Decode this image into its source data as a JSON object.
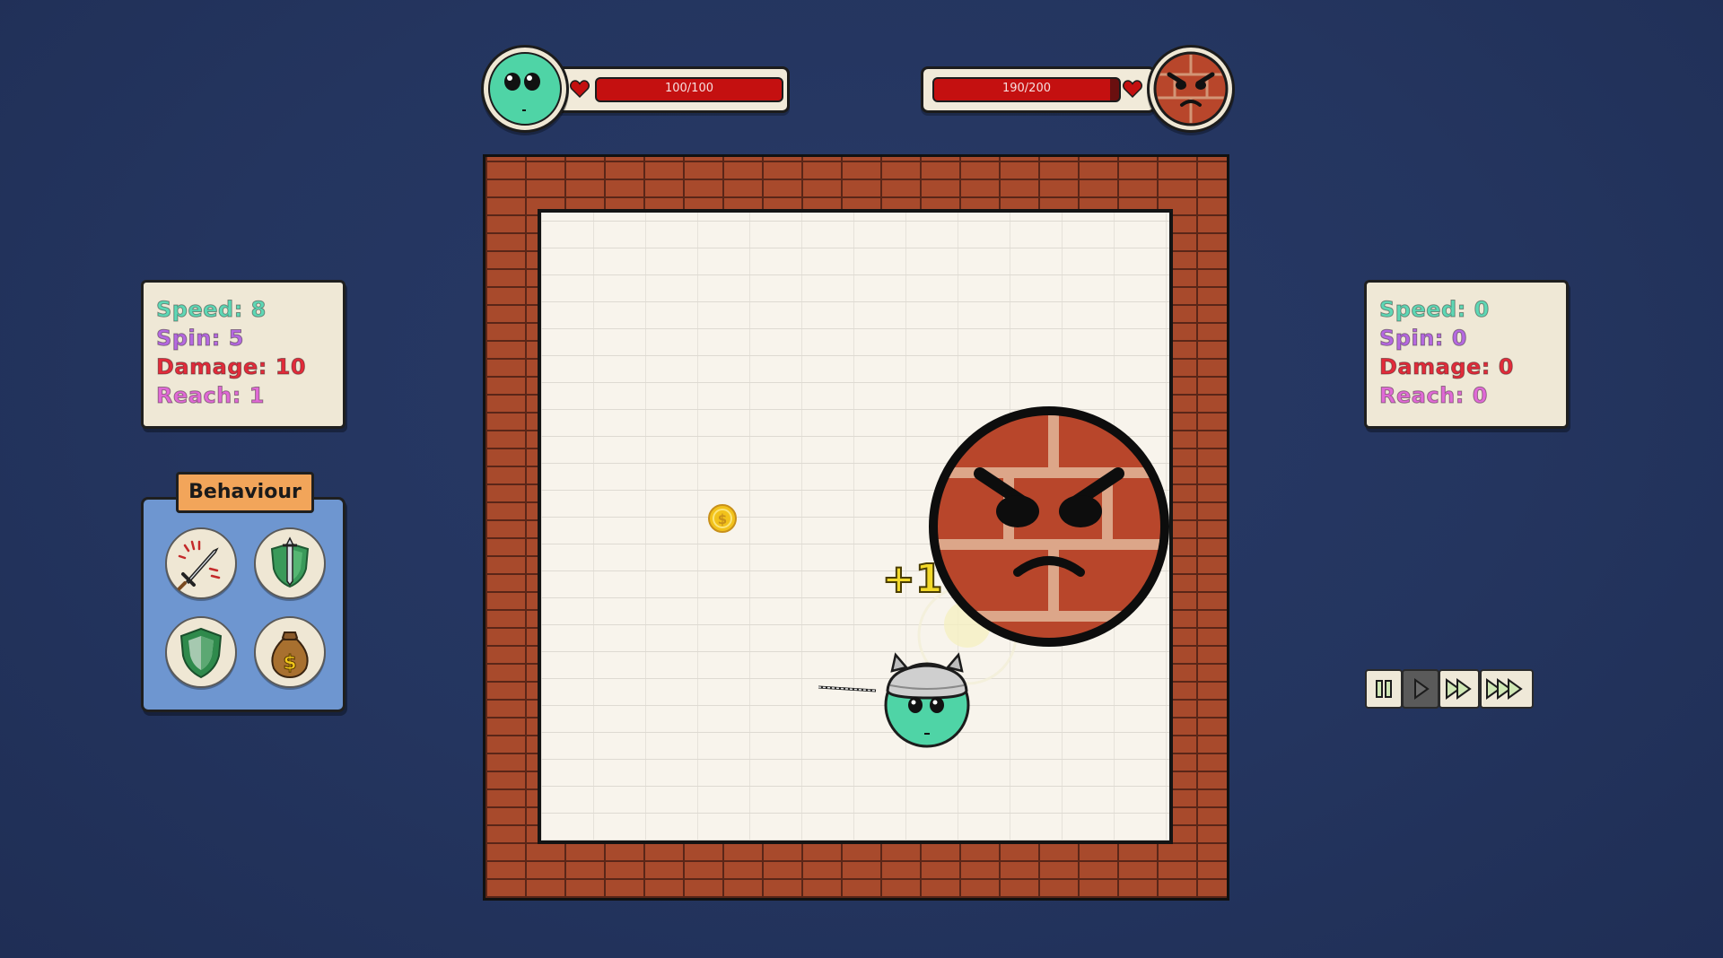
{
  "player": {
    "health": {
      "current": 100,
      "max": 100,
      "label": "100/100",
      "fraction": 1.0
    },
    "stats": [
      {
        "key": "speed",
        "label": "Speed: 8"
      },
      {
        "key": "spin",
        "label": "Spin: 5"
      },
      {
        "key": "damage",
        "label": "Damage: 10"
      },
      {
        "key": "reach",
        "label": "Reach: 1"
      }
    ]
  },
  "enemy": {
    "health": {
      "current": 190,
      "max": 200,
      "label": "190/200",
      "fraction": 0.95
    },
    "stats": [
      {
        "key": "speed",
        "label": "Speed: 0"
      },
      {
        "key": "spin",
        "label": "Spin: 0"
      },
      {
        "key": "damage",
        "label": "Damage: 0"
      },
      {
        "key": "reach",
        "label": "Reach: 0"
      }
    ]
  },
  "behaviour": {
    "title": "Behaviour",
    "options": [
      {
        "name": "attack",
        "icon": "sword-strike-icon"
      },
      {
        "name": "balanced",
        "icon": "sword-shield-icon"
      },
      {
        "name": "defend",
        "icon": "shield-icon"
      },
      {
        "name": "collect",
        "icon": "money-bag-icon"
      }
    ]
  },
  "arena": {
    "floating_text": "+1",
    "coin_symbol": "$"
  },
  "speed_controls": [
    {
      "name": "pause",
      "icon": "pause-icon",
      "active": false
    },
    {
      "name": "play",
      "icon": "play-icon",
      "active": true
    },
    {
      "name": "fast-forward",
      "icon": "fast-forward-icon",
      "active": false
    },
    {
      "name": "fastest",
      "icon": "triple-forward-icon",
      "active": false
    }
  ],
  "colors": {
    "background": "#24355f",
    "player_green": "#4fd4a6",
    "enemy_brick": "#b8462b",
    "health_red": "#c41010",
    "stat_speed": "#5fd7b5",
    "stat_spin": "#b569e0",
    "stat_damage": "#e22b3a",
    "stat_reach": "#e06ad6",
    "behaviour_panel": "#6e96d0",
    "behaviour_tab": "#f2a55a"
  }
}
